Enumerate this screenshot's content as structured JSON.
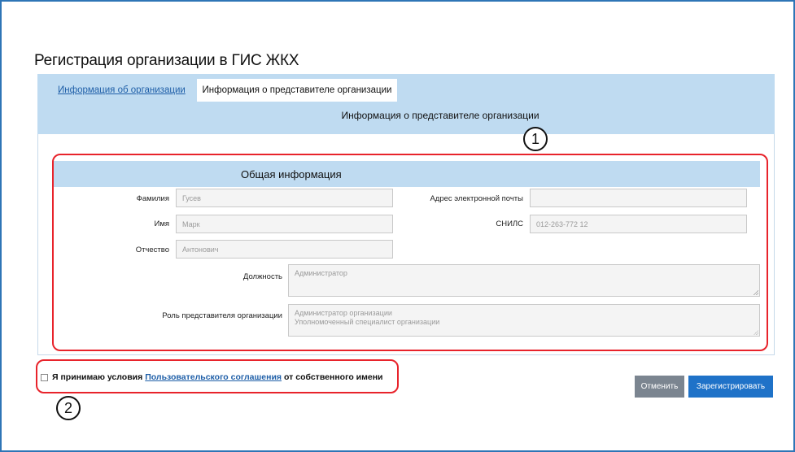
{
  "page": {
    "title": "Регистрация организации в ГИС ЖКХ"
  },
  "tabs": [
    {
      "label": "Информация об организации",
      "active": false
    },
    {
      "label": "Информация о представителе организации",
      "active": true
    }
  ],
  "section_title": "Информация о представителе организации",
  "group": {
    "title": "Общая информация",
    "fields": {
      "last_name": {
        "label": "Фамилия",
        "value": "Гусев"
      },
      "first_name": {
        "label": "Имя",
        "value": "Марк"
      },
      "middle_name": {
        "label": "Отчество",
        "value": "Антонович"
      },
      "email": {
        "label": "Адрес электронной почты",
        "value": ""
      },
      "snils": {
        "label": "СНИЛС",
        "value": "012-263-772 12"
      },
      "position": {
        "label": "Должность",
        "value": "Администратор"
      },
      "role": {
        "label": "Роль представителя организации",
        "values": [
          "Администратор организации",
          "Уполномоченный специалист организации"
        ]
      }
    }
  },
  "agreement": {
    "text_before": "Я принимаю условия",
    "link": "Пользовательского соглашения",
    "text_after": "от собственного имени",
    "checked": false
  },
  "buttons": {
    "cancel": "Отменить",
    "register": "Зарегистрировать"
  },
  "callouts": [
    "1",
    "2"
  ],
  "colors": {
    "accent": "#1f72c8",
    "header_bg": "#bfdbf1",
    "highlight": "#e8232b",
    "frame": "#2e75b6"
  }
}
